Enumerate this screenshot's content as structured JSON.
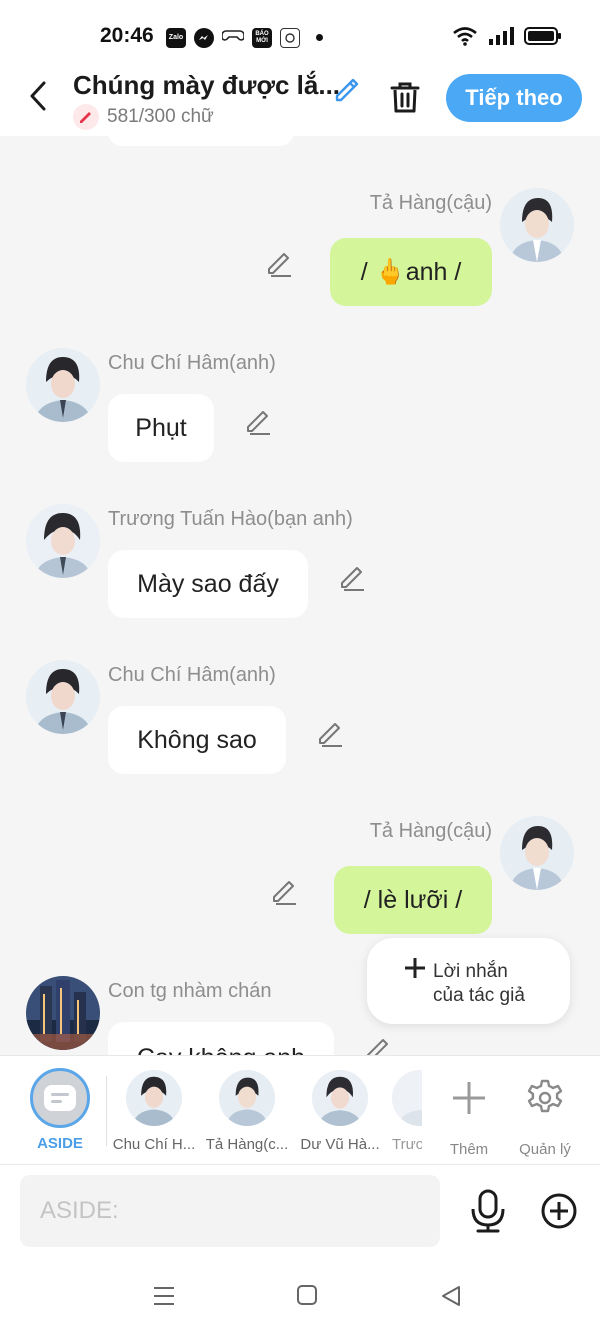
{
  "status_bar": {
    "time": "20:46",
    "app_icons": [
      "Zalo",
      "messenger",
      "game",
      "BÁO MỚI",
      "video"
    ]
  },
  "header": {
    "title": "Chúng mày được lắ...",
    "word_count": "581/300 chữ",
    "next_label": "Tiếp theo"
  },
  "colors": {
    "accent": "#4aa8f5",
    "green_bubble": "#d4f59a",
    "background": "#f5f5f5"
  },
  "messages": [
    {
      "side": "right",
      "name": "Tả Hàng(cậu)",
      "text": "/ 🖕anh /"
    },
    {
      "side": "left",
      "name": "Chu Chí Hâm(anh)",
      "text": "Phụt"
    },
    {
      "side": "left",
      "name": "Trương Tuấn Hào(bạn anh)",
      "text": "Mày sao đấy"
    },
    {
      "side": "left",
      "name": "Chu Chí Hâm(anh)",
      "text": "Không sao"
    },
    {
      "side": "right",
      "name": "Tả Hàng(cậu)",
      "text": "/ lè lưỡi /"
    },
    {
      "side": "left",
      "name": "Con tg nhàm chán",
      "text": "Cay không anh"
    }
  ],
  "author_note": {
    "line1": "Lời nhắn",
    "line2": "của tác giả"
  },
  "characters": {
    "aside_label": "ASIDE",
    "items": [
      "Chu Chí H...",
      "Tả Hàng(c...",
      "Dư Vũ Hà...",
      "Trươ"
    ],
    "add_label": "Thêm",
    "manage_label": "Quản lý"
  },
  "input": {
    "placeholder": "ASIDE:"
  }
}
